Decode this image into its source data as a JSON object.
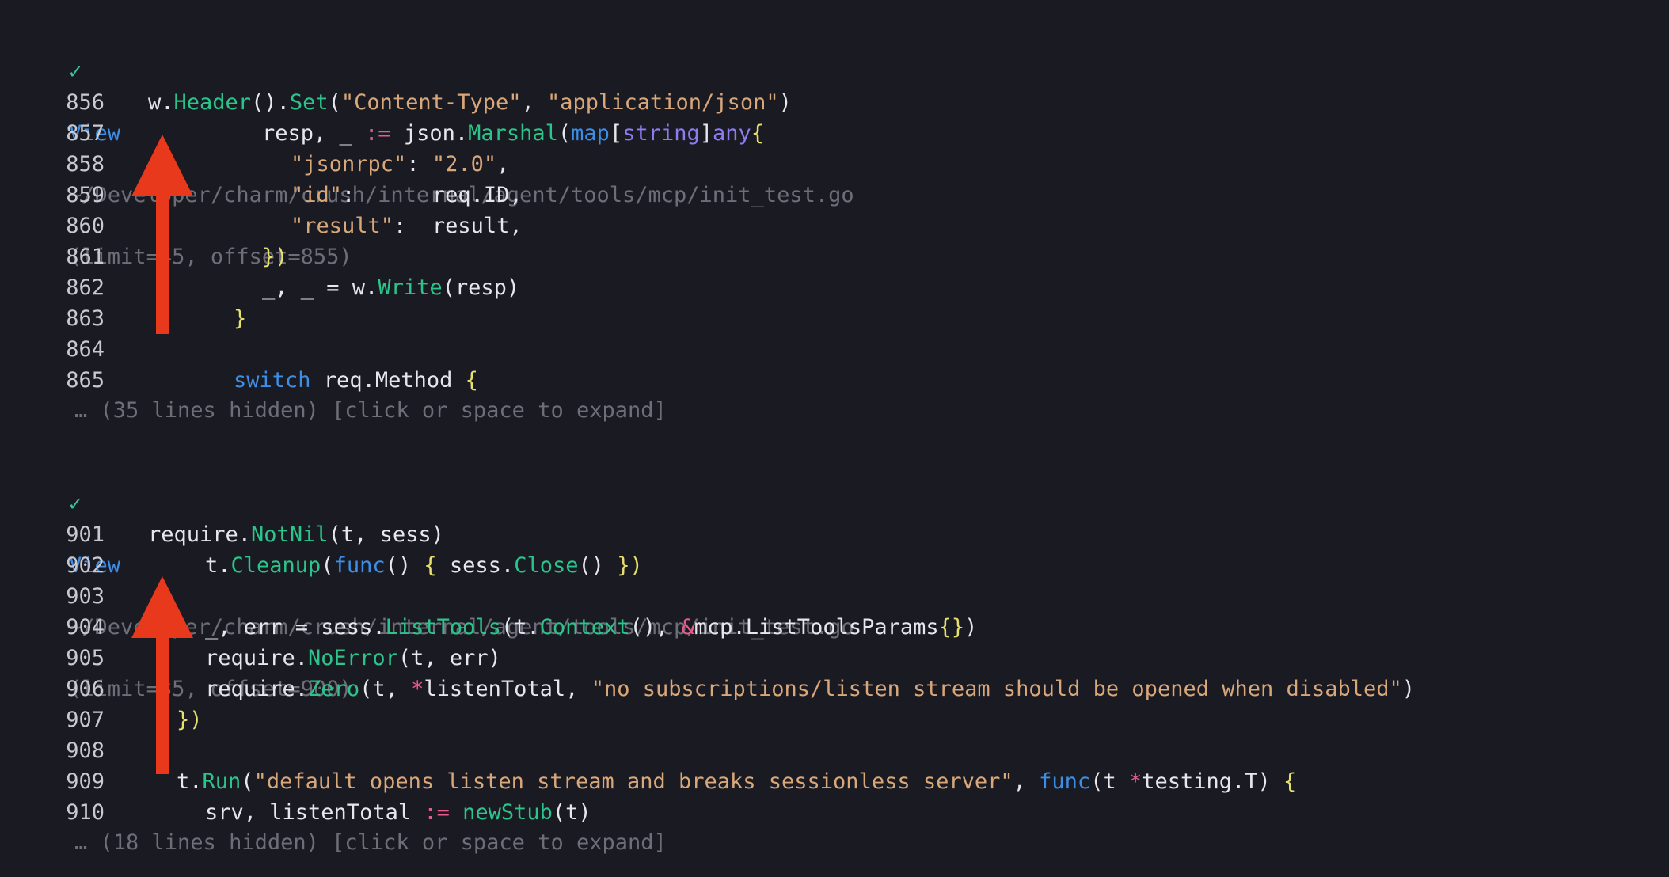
{
  "blocks": [
    {
      "header": {
        "check": "✓",
        "label": "View",
        "path": "~/Developer/charm/crush/internal/agent/tools/mcp/init_test.go",
        "params": "(limit=45, offset=855)"
      },
      "lines": [
        {
          "num": "856",
          "indent": 0,
          "tokens": [
            {
              "t": "w.",
              "c": "plain"
            },
            {
              "t": "Header",
              "c": "fn"
            },
            {
              "t": "().",
              "c": "plain"
            },
            {
              "t": "Set",
              "c": "fn"
            },
            {
              "t": "(",
              "c": "plain"
            },
            {
              "t": "\"Content-Type\"",
              "c": "str"
            },
            {
              "t": ", ",
              "c": "plain"
            },
            {
              "t": "\"application/json\"",
              "c": "str"
            },
            {
              "t": ")",
              "c": "plain"
            }
          ]
        },
        {
          "num": "857",
          "indent": 8,
          "tokens": [
            {
              "t": "resp, _ ",
              "c": "plain"
            },
            {
              "t": ":=",
              "c": "op"
            },
            {
              "t": " json.",
              "c": "plain"
            },
            {
              "t": "Marshal",
              "c": "fn"
            },
            {
              "t": "(",
              "c": "plain"
            },
            {
              "t": "map",
              "c": "kw"
            },
            {
              "t": "[",
              "c": "plain"
            },
            {
              "t": "string",
              "c": "type"
            },
            {
              "t": "]",
              "c": "plain"
            },
            {
              "t": "any",
              "c": "type"
            },
            {
              "t": "{",
              "c": "brace"
            }
          ]
        },
        {
          "num": "858",
          "indent": 10,
          "tokens": [
            {
              "t": "\"jsonrpc\"",
              "c": "str"
            },
            {
              "t": ": ",
              "c": "plain"
            },
            {
              "t": "\"2.0\"",
              "c": "str"
            },
            {
              "t": ",",
              "c": "plain"
            }
          ]
        },
        {
          "num": "859",
          "indent": 10,
          "tokens": [
            {
              "t": "\"id\"",
              "c": "str"
            },
            {
              "t": ":      req.ID,",
              "c": "plain"
            }
          ]
        },
        {
          "num": "860",
          "indent": 10,
          "tokens": [
            {
              "t": "\"result\"",
              "c": "str"
            },
            {
              "t": ":  result,",
              "c": "plain"
            }
          ]
        },
        {
          "num": "861",
          "indent": 8,
          "tokens": [
            {
              "t": "})",
              "c": "brace"
            }
          ]
        },
        {
          "num": "862",
          "indent": 8,
          "tokens": [
            {
              "t": "_, _ = w.",
              "c": "plain"
            },
            {
              "t": "Write",
              "c": "fn"
            },
            {
              "t": "(resp)",
              "c": "plain"
            }
          ]
        },
        {
          "num": "863",
          "indent": 6,
          "tokens": [
            {
              "t": "}",
              "c": "brace"
            }
          ]
        },
        {
          "num": "864",
          "indent": 0,
          "tokens": []
        },
        {
          "num": "865",
          "indent": 6,
          "tokens": [
            {
              "t": "switch",
              "c": "kw"
            },
            {
              "t": " req.Method ",
              "c": "plain"
            },
            {
              "t": "{",
              "c": "brace"
            }
          ]
        }
      ],
      "hidden_note": "… (35 lines hidden) [click or space to expand]"
    },
    {
      "header": {
        "check": "✓",
        "label": "View",
        "path": "~/Developer/charm/crush/internal/agent/tools/mcp/init_test.go",
        "params": "(limit=35, offset=900)"
      },
      "lines": [
        {
          "num": "901",
          "indent": 0,
          "tokens": [
            {
              "t": "require.",
              "c": "plain"
            },
            {
              "t": "NotNil",
              "c": "fn"
            },
            {
              "t": "(t, sess)",
              "c": "plain"
            }
          ]
        },
        {
          "num": "902",
          "indent": 4,
          "tokens": [
            {
              "t": "t.",
              "c": "plain"
            },
            {
              "t": "Cleanup",
              "c": "fn"
            },
            {
              "t": "(",
              "c": "plain"
            },
            {
              "t": "func",
              "c": "kw"
            },
            {
              "t": "() ",
              "c": "plain"
            },
            {
              "t": "{",
              "c": "brace"
            },
            {
              "t": " sess.",
              "c": "plain"
            },
            {
              "t": "Close",
              "c": "fn"
            },
            {
              "t": "() ",
              "c": "plain"
            },
            {
              "t": "})",
              "c": "brace"
            }
          ]
        },
        {
          "num": "903",
          "indent": 0,
          "tokens": []
        },
        {
          "num": "904",
          "indent": 4,
          "tokens": [
            {
              "t": "_, err = sess.",
              "c": "plain"
            },
            {
              "t": "ListTools",
              "c": "fn"
            },
            {
              "t": "(t.",
              "c": "plain"
            },
            {
              "t": "Context",
              "c": "fn"
            },
            {
              "t": "(), ",
              "c": "plain"
            },
            {
              "t": "&",
              "c": "op"
            },
            {
              "t": "mcp.ListToolsParams",
              "c": "plain"
            },
            {
              "t": "{}",
              "c": "brace"
            },
            {
              "t": ")",
              "c": "plain"
            }
          ]
        },
        {
          "num": "905",
          "indent": 4,
          "tokens": [
            {
              "t": "require.",
              "c": "plain"
            },
            {
              "t": "NoError",
              "c": "fn"
            },
            {
              "t": "(t, err)",
              "c": "plain"
            }
          ]
        },
        {
          "num": "906",
          "indent": 4,
          "tokens": [
            {
              "t": "require.",
              "c": "plain"
            },
            {
              "t": "Zero",
              "c": "fn"
            },
            {
              "t": "(t, ",
              "c": "plain"
            },
            {
              "t": "*",
              "c": "op"
            },
            {
              "t": "listenTotal, ",
              "c": "plain"
            },
            {
              "t": "\"no subscriptions/listen stream should be opened when disabled\"",
              "c": "str"
            },
            {
              "t": ")",
              "c": "plain"
            }
          ]
        },
        {
          "num": "907",
          "indent": 2,
          "tokens": [
            {
              "t": "})",
              "c": "brace"
            }
          ]
        },
        {
          "num": "908",
          "indent": 0,
          "tokens": []
        },
        {
          "num": "909",
          "indent": 2,
          "tokens": [
            {
              "t": "t.",
              "c": "plain"
            },
            {
              "t": "Run",
              "c": "fn"
            },
            {
              "t": "(",
              "c": "plain"
            },
            {
              "t": "\"default opens listen stream and breaks sessionless server\"",
              "c": "str"
            },
            {
              "t": ", ",
              "c": "plain"
            },
            {
              "t": "func",
              "c": "kw"
            },
            {
              "t": "(t ",
              "c": "plain"
            },
            {
              "t": "*",
              "c": "op"
            },
            {
              "t": "testing.T) ",
              "c": "plain"
            },
            {
              "t": "{",
              "c": "brace"
            }
          ]
        },
        {
          "num": "910",
          "indent": 4,
          "tokens": [
            {
              "t": "srv, listenTotal ",
              "c": "plain"
            },
            {
              "t": ":=",
              "c": "op"
            },
            {
              "t": " ",
              "c": "plain"
            },
            {
              "t": "newStub",
              "c": "fn"
            },
            {
              "t": "(t)",
              "c": "plain"
            }
          ]
        }
      ],
      "hidden_note": "… (18 lines hidden) [click or space to expand]"
    }
  ],
  "arrows": [
    {
      "name": "annotation-arrow-up-1",
      "color": "#e8391c"
    },
    {
      "name": "annotation-arrow-up-2",
      "color": "#e8391c"
    }
  ]
}
